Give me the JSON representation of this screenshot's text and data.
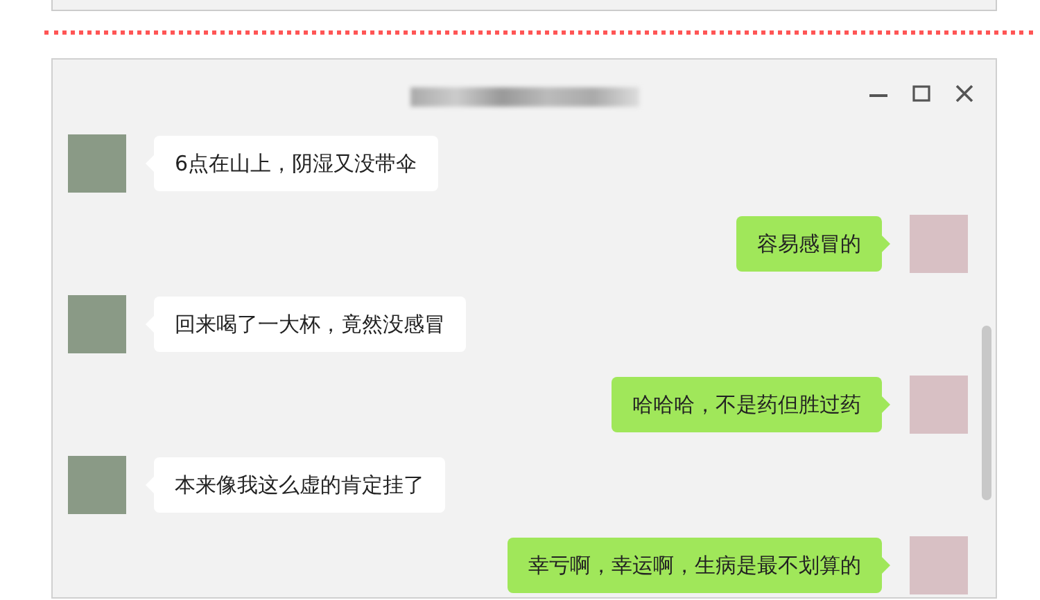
{
  "chat_window": {
    "messages": [
      {
        "kind": "received",
        "text": "6点在山上，阴湿又没带伞"
      },
      {
        "kind": "sent",
        "text": "容易感冒的"
      },
      {
        "kind": "received",
        "text": "回来喝了一大杯，竟然没感冒"
      },
      {
        "kind": "sent",
        "text": "哈哈哈，不是药但胜过药"
      },
      {
        "kind": "received",
        "text": "本来像我这么虚的肯定挂了"
      },
      {
        "kind": "sent",
        "text": "幸亏啊，幸运啊，生病是最不划算的"
      }
    ]
  }
}
